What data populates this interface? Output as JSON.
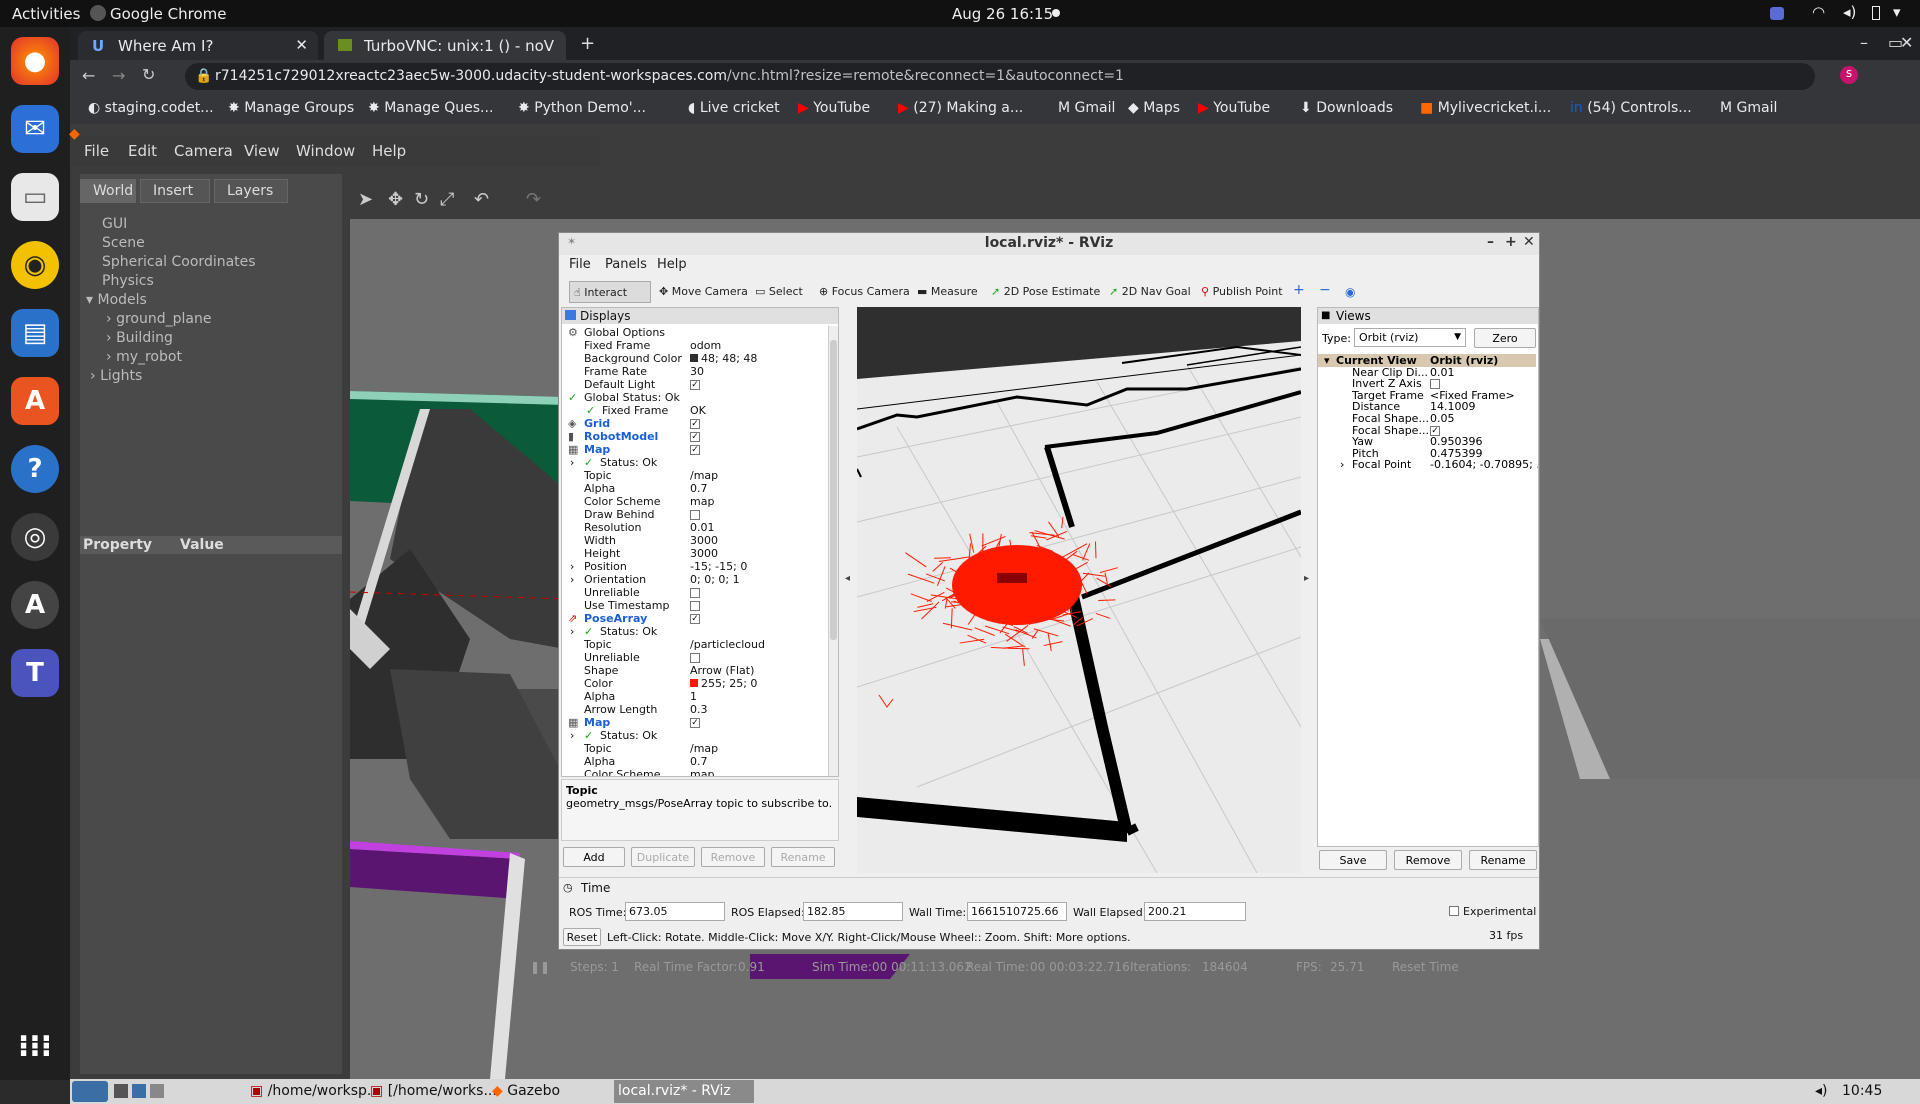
{
  "topbar": {
    "activities": "Activities",
    "app": "Google Chrome",
    "clock": "Aug 26  16:15"
  },
  "chrome": {
    "tabs": [
      {
        "title": "Where Am I?"
      },
      {
        "title": "TurboVNC: unix:1 () - noV"
      }
    ],
    "url_host": "r714251c729012xreactc23aec5w-3000.udacity-student-workspaces.com",
    "url_path": "/vnc.html?resize=remote&reconnect=1&autoconnect=1",
    "bookmarks": [
      "staging.codet...",
      "Manage Groups",
      "Manage Ques...",
      "Python Demo'...",
      "Live cricket",
      "YouTube",
      "(27) Making a...",
      "Gmail",
      "Maps",
      "YouTube",
      "Downloads",
      "Mylivecricket.i...",
      "(54) Controls...",
      "Gmail"
    ],
    "profile_initial": "s"
  },
  "gazebo": {
    "menu": [
      "File",
      "Edit",
      "Camera",
      "View",
      "Window",
      "Help"
    ],
    "tabs": [
      "World",
      "Insert",
      "Layers"
    ],
    "tree": [
      "GUI",
      "Scene",
      "Spherical Coordinates",
      "Physics",
      "Models",
      "ground_plane",
      "Building",
      "my_robot",
      "Lights"
    ],
    "prop_header": "Property",
    "value_header": "Value",
    "status": {
      "steps": "Steps: 1",
      "rtf_label": "Real Time Factor:",
      "rtf": "0.91",
      "sim_label": "Sim Time:",
      "sim": "00 00:11:13.062",
      "real_label": "Real Time:",
      "real": "00 00:03:22.716",
      "iter_label": "Iterations:",
      "iter": "184604",
      "fps_label": "FPS:",
      "fps": "25.71",
      "reset": "Reset Time"
    }
  },
  "rviz": {
    "title": "local.rviz* - RViz",
    "menu": [
      "File",
      "Panels",
      "Help"
    ],
    "tools": [
      "Interact",
      "Move Camera",
      "Select",
      "Focus Camera",
      "Measure",
      "2D Pose Estimate",
      "2D Nav Goal",
      "Publish Point"
    ],
    "displays_title": "Displays",
    "rows": [
      {
        "k": "Global Options",
        "v": ""
      },
      {
        "k": "Fixed Frame",
        "v": "odom"
      },
      {
        "k": "Background Color",
        "v": "48; 48; 48"
      },
      {
        "k": "Frame Rate",
        "v": "30"
      },
      {
        "k": "Default Light",
        "v": "✓"
      },
      {
        "k": "Global Status: Ok",
        "v": ""
      },
      {
        "k": "Fixed Frame",
        "v": "OK"
      },
      {
        "k": "Grid",
        "v": "✓"
      },
      {
        "k": "RobotModel",
        "v": "✓"
      },
      {
        "k": "Map",
        "v": "✓"
      },
      {
        "k": "Status: Ok",
        "v": ""
      },
      {
        "k": "Topic",
        "v": "/map"
      },
      {
        "k": "Alpha",
        "v": "0.7"
      },
      {
        "k": "Color Scheme",
        "v": "map"
      },
      {
        "k": "Draw Behind",
        "v": ""
      },
      {
        "k": "Resolution",
        "v": "0.01"
      },
      {
        "k": "Width",
        "v": "3000"
      },
      {
        "k": "Height",
        "v": "3000"
      },
      {
        "k": "Position",
        "v": "-15; -15; 0"
      },
      {
        "k": "Orientation",
        "v": "0; 0; 0; 1"
      },
      {
        "k": "Unreliable",
        "v": ""
      },
      {
        "k": "Use Timestamp",
        "v": ""
      },
      {
        "k": "PoseArray",
        "v": "✓"
      },
      {
        "k": "Status: Ok",
        "v": ""
      },
      {
        "k": "Topic",
        "v": "/particlecloud"
      },
      {
        "k": "Unreliable",
        "v": ""
      },
      {
        "k": "Shape",
        "v": "Arrow (Flat)"
      },
      {
        "k": "Color",
        "v": "255; 25; 0"
      },
      {
        "k": "Alpha",
        "v": "1"
      },
      {
        "k": "Arrow Length",
        "v": "0.3"
      },
      {
        "k": "Map",
        "v": "✓"
      },
      {
        "k": "Status: Ok",
        "v": ""
      },
      {
        "k": "Topic",
        "v": "/map"
      },
      {
        "k": "Alpha",
        "v": "0.7"
      },
      {
        "k": "Color Scheme",
        "v": "map"
      }
    ],
    "topic_title": "Topic",
    "topic_desc": "geometry_msgs/PoseArray topic to subscribe to.",
    "buttons": [
      "Add",
      "Duplicate",
      "Remove",
      "Rename"
    ],
    "views": {
      "title": "Views",
      "type_label": "Type:",
      "type": "Orbit (rviz)",
      "zero": "Zero",
      "rows": [
        {
          "k": "Current View",
          "v": "Orbit (rviz)"
        },
        {
          "k": "Near Clip Di...",
          "v": "0.01"
        },
        {
          "k": "Invert Z Axis",
          "v": ""
        },
        {
          "k": "Target Frame",
          "v": "<Fixed Frame>"
        },
        {
          "k": "Distance",
          "v": "14.1009"
        },
        {
          "k": "Focal Shape...",
          "v": "0.05"
        },
        {
          "k": "Focal Shape...",
          "v": "✓"
        },
        {
          "k": "Yaw",
          "v": "0.950396"
        },
        {
          "k": "Pitch",
          "v": "0.475399"
        },
        {
          "k": "Focal Point",
          "v": "-0.1604; -0.70895; ..."
        }
      ],
      "buttons": [
        "Save",
        "Remove",
        "Rename"
      ]
    },
    "time": {
      "title": "Time",
      "ros_time_label": "ROS Time:",
      "ros_time": "673.05",
      "ros_elapsed_label": "ROS Elapsed:",
      "ros_elapsed": "182.85",
      "wall_time_label": "Wall Time:",
      "wall_time": "1661510725.66",
      "wall_elapsed_label": "Wall Elapsed:",
      "wall_elapsed": "200.21",
      "experimental": "Experimental",
      "reset": "Reset",
      "help": "Left-Click: Rotate. Middle-Click: Move X/Y. Right-Click/Mouse Wheel:: Zoom. Shift: More options.",
      "fps": "31 fps"
    }
  },
  "taskbar": {
    "items": [
      "/home/worksp...",
      "[/home/works...",
      "Gazebo",
      "local.rviz* - RViz"
    ],
    "clock": "10:45"
  },
  "colors": {
    "red": "#ff1a00",
    "map_black": "#000000",
    "rviz_bg": "#ebebeb"
  }
}
